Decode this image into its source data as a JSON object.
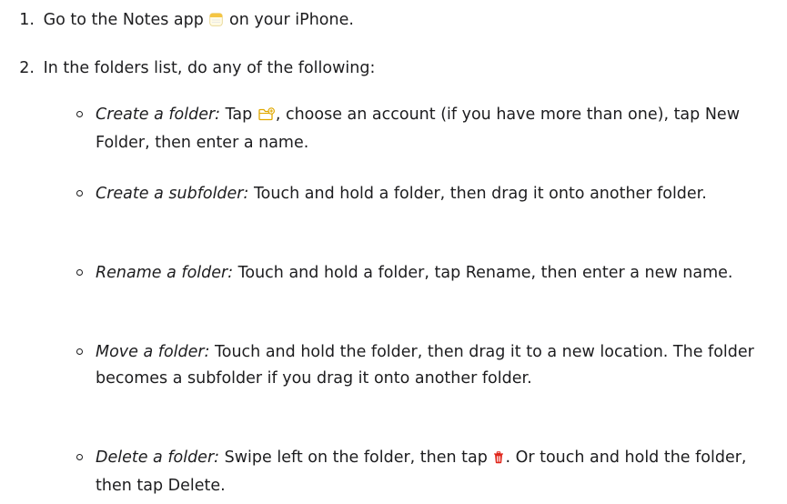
{
  "steps": [
    {
      "number": "1.",
      "text_before": "Go to the Notes app ",
      "icon": "notes-app-icon",
      "text_after": " on your iPhone."
    },
    {
      "number": "2.",
      "text": "In the folders list, do any of the following:"
    }
  ],
  "subitems": [
    {
      "term": "Create a folder:",
      "text_before": " Tap ",
      "icon": "new-folder-icon",
      "text_after": ", choose an account (if you have more than one), tap New Folder, then enter a name."
    },
    {
      "term": "Create a subfolder:",
      "text": " Touch and hold a folder, then drag it onto another folder."
    },
    {
      "term": "Rename a folder:",
      "text": " Touch and hold a folder, tap Rename, then enter a new name."
    },
    {
      "term": "Move a folder:",
      "text": " Touch and hold the folder, then drag it to a new location. The folder becomes a subfolder if you drag it onto another folder."
    },
    {
      "term": "Delete a folder:",
      "text_before": " Swipe left on the folder, then tap ",
      "icon": "trash-icon",
      "text_after": ". Or touch and hold the folder, then tap Delete."
    }
  ],
  "colors": {
    "text": "#1d1d1f",
    "notes_icon": "#f5c542",
    "folder_icon": "#e0a800",
    "trash_icon": "#e0261b"
  }
}
